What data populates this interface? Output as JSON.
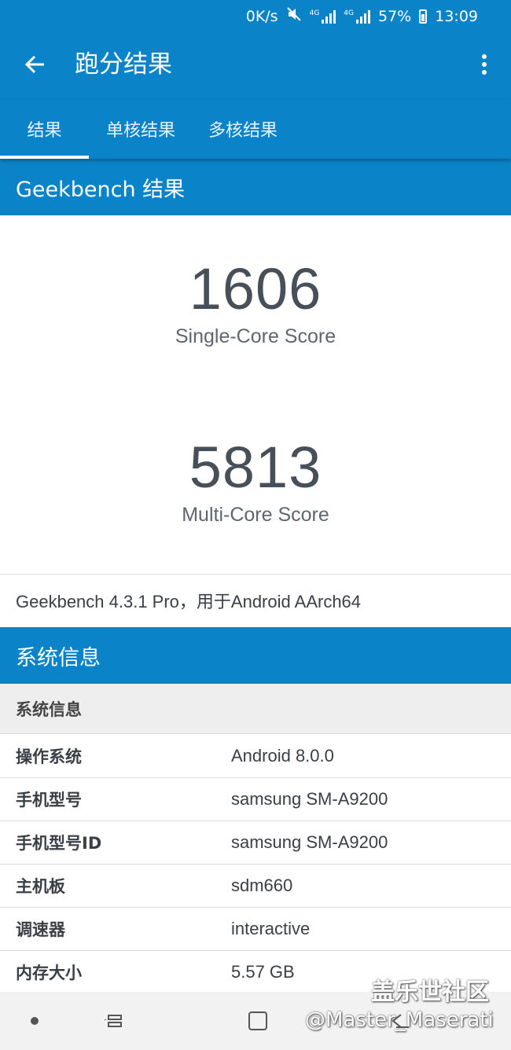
{
  "colors": {
    "primary": "#0b83c8",
    "nav_bar": "#f2f2f2",
    "group_bg": "#eeeeee"
  },
  "status_bar": {
    "net_speed": "0K/s",
    "network_1": "4G",
    "network_2": "4G",
    "battery": "57%",
    "time": "13:09"
  },
  "app_bar": {
    "title": "跑分结果"
  },
  "tabs": [
    {
      "label": "结果",
      "active": true
    },
    {
      "label": "单核结果",
      "active": false
    },
    {
      "label": "多核结果",
      "active": false
    }
  ],
  "results_header": "Geekbench 结果",
  "scores": {
    "single": {
      "value": "1606",
      "label": "Single-Core Score"
    },
    "multi": {
      "value": "5813",
      "label": "Multi-Core Score"
    }
  },
  "version_text": "Geekbench 4.3.1 Pro，用于Android AArch64",
  "system_header": "系统信息",
  "system_group": "系统信息",
  "system_rows": [
    {
      "key": "操作系统",
      "value": "Android 8.0.0"
    },
    {
      "key": "手机型号",
      "value": "samsung SM-A9200"
    },
    {
      "key": "手机型号ID",
      "value": "samsung SM-A9200"
    },
    {
      "key": "主机板",
      "value": "sdm660"
    },
    {
      "key": "调速器",
      "value": "interactive"
    },
    {
      "key": "内存大小",
      "value": "5.57 GB"
    }
  ],
  "watermark": {
    "site": "盖乐世社区",
    "user": "@Master_Maserati"
  },
  "icons": {
    "back": "arrow-left-icon",
    "more": "more-vert-icon",
    "mute": "mute-icon",
    "signal": "signal-icon",
    "battery": "battery-icon",
    "nav_recents": "recents-icon",
    "nav_home": "home-icon",
    "nav_back": "back-nav-icon"
  }
}
